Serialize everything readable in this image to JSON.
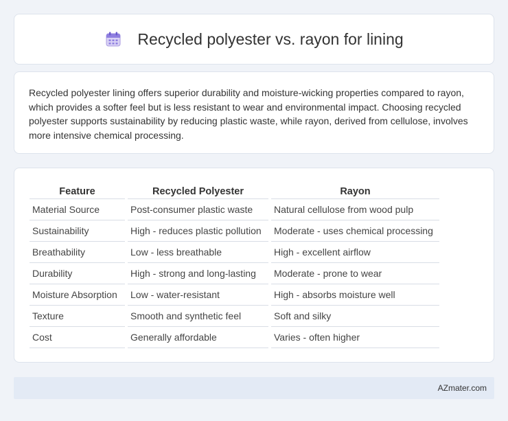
{
  "header": {
    "title": "Recycled polyester vs. rayon for lining",
    "icon": "calendar-icon"
  },
  "description": {
    "text": "Recycled polyester lining offers superior durability and moisture-wicking properties compared to rayon, which provides a softer feel but is less resistant to wear and environmental impact. Choosing recycled polyester supports sustainability by reducing plastic waste, while rayon, derived from cellulose, involves more intensive chemical processing."
  },
  "table": {
    "headers": [
      "Feature",
      "Recycled Polyester",
      "Rayon"
    ],
    "rows": [
      [
        "Material Source",
        "Post-consumer plastic waste",
        "Natural cellulose from wood pulp"
      ],
      [
        "Sustainability",
        "High - reduces plastic pollution",
        "Moderate - uses chemical processing"
      ],
      [
        "Breathability",
        "Low - less breathable",
        "High - excellent airflow"
      ],
      [
        "Durability",
        "High - strong and long-lasting",
        "Moderate - prone to wear"
      ],
      [
        "Moisture Absorption",
        "Low - water-resistant",
        "High - absorbs moisture well"
      ],
      [
        "Texture",
        "Smooth and synthetic feel",
        "Soft and silky"
      ],
      [
        "Cost",
        "Generally affordable",
        "Varies - often higher"
      ]
    ]
  },
  "footer": {
    "brand": "AZmater.com"
  },
  "colors": {
    "background": "#f0f3f8",
    "card": "#ffffff",
    "footer_bg": "#e3eaf5"
  }
}
